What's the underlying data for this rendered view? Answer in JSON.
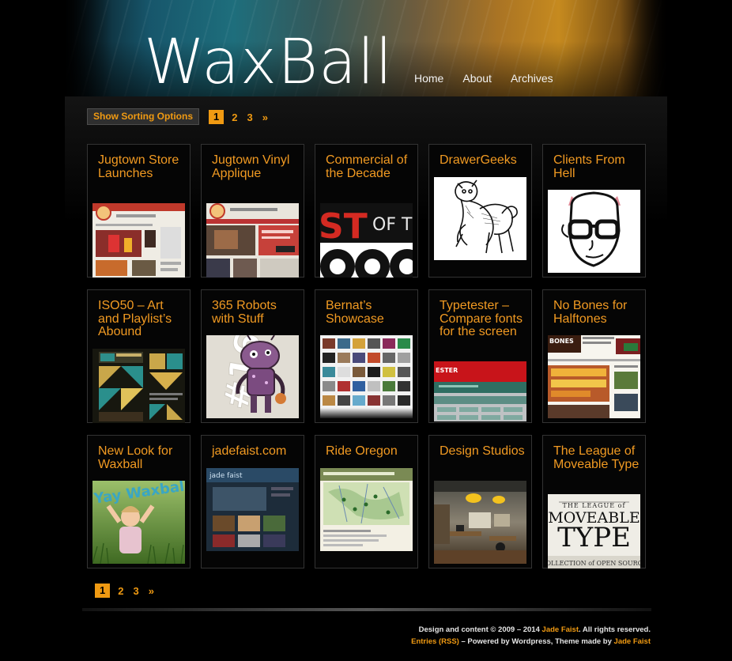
{
  "site": {
    "logo": "WaxBall"
  },
  "nav": {
    "items": [
      {
        "label": "Home"
      },
      {
        "label": "About"
      },
      {
        "label": "Archives"
      }
    ]
  },
  "sorting": {
    "button_label": "Show Sorting Options"
  },
  "pagination": {
    "pages": [
      "1",
      "2",
      "3"
    ],
    "next": "»",
    "current": "1"
  },
  "posts": [
    {
      "title": "Jugtown Store Launches",
      "thumb_icon": "website-screenshot"
    },
    {
      "title": "Jugtown Vinyl Applique",
      "thumb_icon": "website-screenshot"
    },
    {
      "title": "Commercial of the Decade",
      "thumb_icon": "typography-poster"
    },
    {
      "title": "DrawerGeeks",
      "thumb_icon": "sketch-drawing"
    },
    {
      "title": "Clients From Hell",
      "thumb_icon": "face-illustration"
    },
    {
      "title": "ISO50 – Art and Playlist’s Abound",
      "thumb_icon": "geometric-art"
    },
    {
      "title": "365 Robots with Stuff",
      "thumb_icon": "robot-illustration"
    },
    {
      "title": "Bernat’s Showcase",
      "thumb_icon": "photo-grid"
    },
    {
      "title": "Typetester – Compare fonts for the screen",
      "thumb_icon": "website-screenshot"
    },
    {
      "title": "No Bones for Halftones",
      "thumb_icon": "website-screenshot"
    },
    {
      "title": "New Look for Waxball",
      "thumb_icon": "photo-child"
    },
    {
      "title": "jadefaist.com",
      "thumb_icon": "website-screenshot"
    },
    {
      "title": "Ride Oregon",
      "thumb_icon": "map-screenshot"
    },
    {
      "title": "Design Studios",
      "thumb_icon": "office-photo"
    },
    {
      "title": "The League of Moveable Type",
      "thumb_icon": "type-logo"
    }
  ],
  "thumb_text": {
    "p2": "OF T",
    "p6": "#16",
    "p10": "Yay Waxball",
    "p11": "jade faist",
    "p14a": "THE LEAGUE of",
    "p14b": "MOVEABLE",
    "p14c": "TYPE",
    "p14d": "COLLECTION of OPEN SOURCE"
  },
  "footer": {
    "line1_prefix": "Design and content © 2009 – 2014 ",
    "author": "Jade Faist",
    "line1_suffix": ". All rights reserved.",
    "rss_link": "Entries (RSS)",
    "line2_middle": " – Powered by Wordpress, Theme made by ",
    "theme_author": "Jade Faist"
  },
  "colors": {
    "accent": "#f09a12",
    "background": "#000000",
    "card_border": "#333333"
  }
}
